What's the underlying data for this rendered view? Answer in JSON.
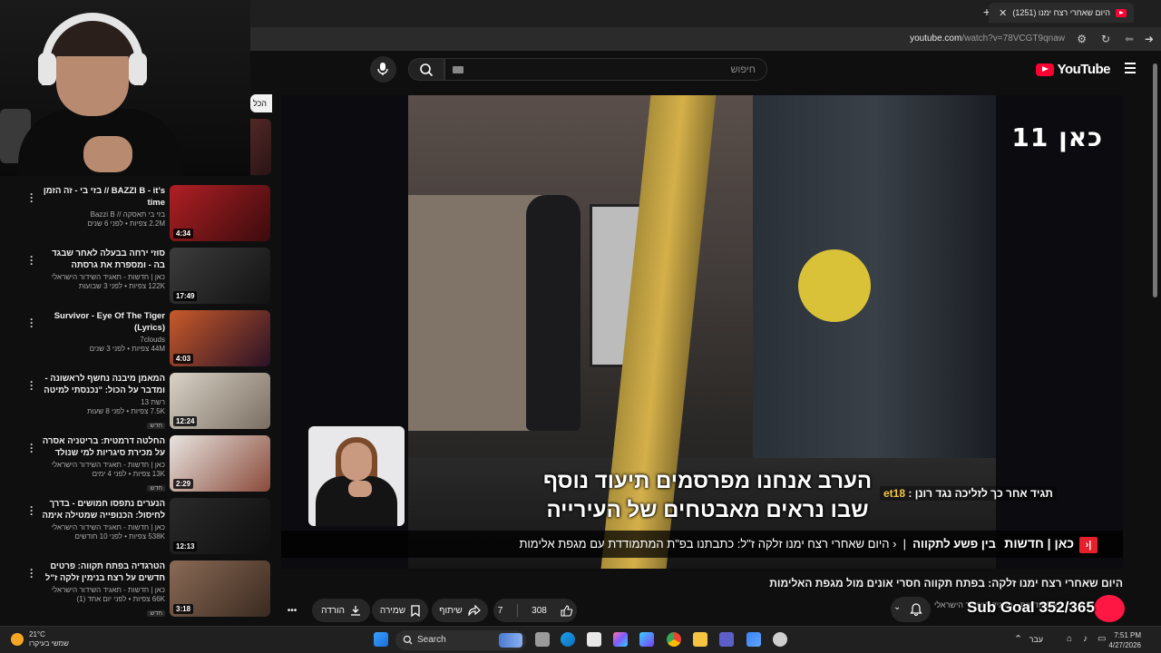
{
  "browser": {
    "tab_title": "(1251) היום שאחרי רצח ימנו",
    "url_host": "youtube.com",
    "url_path": "/watch?v=78VCGT9qnaw"
  },
  "header": {
    "logo_text": "YouTube",
    "search_placeholder": "חיפוש"
  },
  "sidebar": {
    "chip_label": "הכל",
    "items": [
      {
        "title": "BAZZI B - it's // בזי בי - זה הזמן time",
        "channel": "בזי בי תאסקה // Bazzi B",
        "meta": "2.2M צפיות • לפני 6 שנים",
        "badge": "",
        "duration": "4:34",
        "colors": [
          "#b01f24",
          "#3a0b0d"
        ]
      },
      {
        "title": "סוזי ירחה בבעלה לאחר שבגד בה - ומספרת את גרסתה לראשונה ממעצ...",
        "channel": "כאן | חדשות - תאגיד השידור הישראלי",
        "meta": "122K צפיות • לפני 3 שבועות",
        "badge": "",
        "duration": "17:49",
        "colors": [
          "#3c3c3c",
          "#121212"
        ]
      },
      {
        "title": "Survivor - Eye Of The Tiger (Lyrics)",
        "channel": "7clouds",
        "meta": "44M צפיות • לפני 3 שנים",
        "badge": "",
        "duration": "4:03",
        "colors": [
          "#c85a2a",
          "#2a1226"
        ]
      },
      {
        "title": "המאמן מיבנה נחשף לראשונה - ומדבר על הכול: \"נכנסתי למיטה ולא ...",
        "channel": "רשת 13",
        "meta": "7.5K צפיות • לפני 8 שעות",
        "badge": "חדש",
        "duration": "12:24",
        "colors": [
          "#d9d2c6",
          "#7a6e62"
        ]
      },
      {
        "title": "החלטה דרמטית: בריטניה אסרה על מכירת סיגריות למי שנולד אחרי 2009",
        "channel": "כאן | חדשות - תאגיד השידור הישראלי",
        "meta": "13K צפיות • לפני 4 ימים",
        "badge": "חדש",
        "duration": "2:29",
        "colors": [
          "#e8e4e0",
          "#8a4a3a"
        ]
      },
      {
        "title": "הנערים נתפסו חמושים - בדרך לחיסול: הכנופייה שמטילה אימה על...",
        "channel": "כאן | חדשות - תאגיד השידור הישראלי",
        "meta": "538K צפיות • לפני 10 חודשים",
        "badge": "",
        "duration": "12:13",
        "colors": [
          "#2a2a2a",
          "#0e0e0e"
        ]
      },
      {
        "title": "הטרגדיה בפתח תקווה: פרטים חדשים על רצח בנימין זלקה ז\"ל",
        "channel": "כאן | חדשות - תאגיד השידור הישראלי",
        "meta": "66K צפיות • לפני יום אחד (1)",
        "badge": "חדש",
        "duration": "3:18",
        "colors": [
          "#8a6a55",
          "#3a2a20"
        ]
      }
    ]
  },
  "player": {
    "channel_logo": "כאן 11",
    "subtitle_line1": "הערב אנחנו מפרסמים תיעוד נוסף",
    "subtitle_line2": "שבו נראים מאבטחים של העירייה",
    "lower_strip_text": "תגיד אחר כך לזליכה נגד רונן : ",
    "lower_strip_highlight": "et18",
    "ticker_brand": "כאן | חדשות",
    "ticker_show": "בין פשע לתקווה",
    "ticker_headline": "היום שאחרי רצח ימנו זלקה ז\"ל: כתבתנו בפ\"ת המתמודדת עם מגפת אלימות"
  },
  "video": {
    "title": "היום שאחרי רצח ימנו זלקה: בפתח תקווה חסרי אונים מול מגפת האלימות",
    "channel_line": "כאן | חדשות - תאגיד השידור הישראלי",
    "likes": "308",
    "dislikes": "7",
    "share_label": "שיתוף",
    "save_label": "שמירה",
    "download_label": "הורדה"
  },
  "overlay": {
    "sub_goal": "Sub Goal 352/365"
  },
  "taskbar": {
    "temperature": "21°C",
    "weather_desc": "שמשי בעיקרו",
    "search_label": "Search",
    "language": "עבר",
    "time": "7:51 PM",
    "date": "4/27/2026"
  }
}
